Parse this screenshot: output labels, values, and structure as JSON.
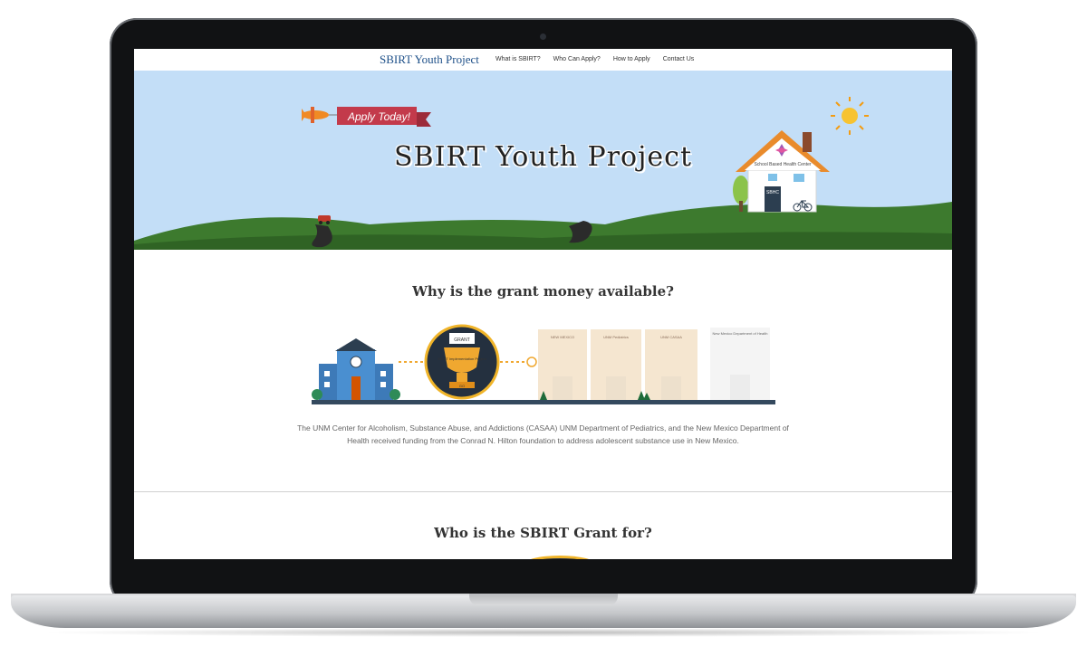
{
  "nav": {
    "brand": "SBIRT Youth Project",
    "links": [
      "What is SBIRT?",
      "Who Can Apply?",
      "How to Apply",
      "Contact Us"
    ]
  },
  "hero": {
    "title": "SBIRT Youth Project",
    "banner": "Apply Today!",
    "house_sign": "School Based Health Center",
    "house_door": "SBHC"
  },
  "section1": {
    "title": "Why is the grant money available?",
    "description": "The UNM Center for Alcoholism, Substance Abuse, and Addictions (CASAA) UNM Department of Pediatrics, and the New Mexico Department of Health received funding from the Conrad N. Hilton foundation to address adolescent substance use in New Mexico.",
    "trophy_label": "SBIRT Implementation Project",
    "trophy_banner": "GRANT",
    "trophy_ribbon": "GO",
    "buildings": [
      "NEW MEXICO",
      "UNM Pediatrics",
      "UNM CASAA",
      "New Mexico Department of Health"
    ]
  },
  "section2": {
    "title": "Who is the SBIRT Grant for?"
  },
  "colors": {
    "sky": "#c3def7",
    "grass": "#3d7a2e",
    "brand": "#1d4f88",
    "banner": "#c33a4b"
  }
}
